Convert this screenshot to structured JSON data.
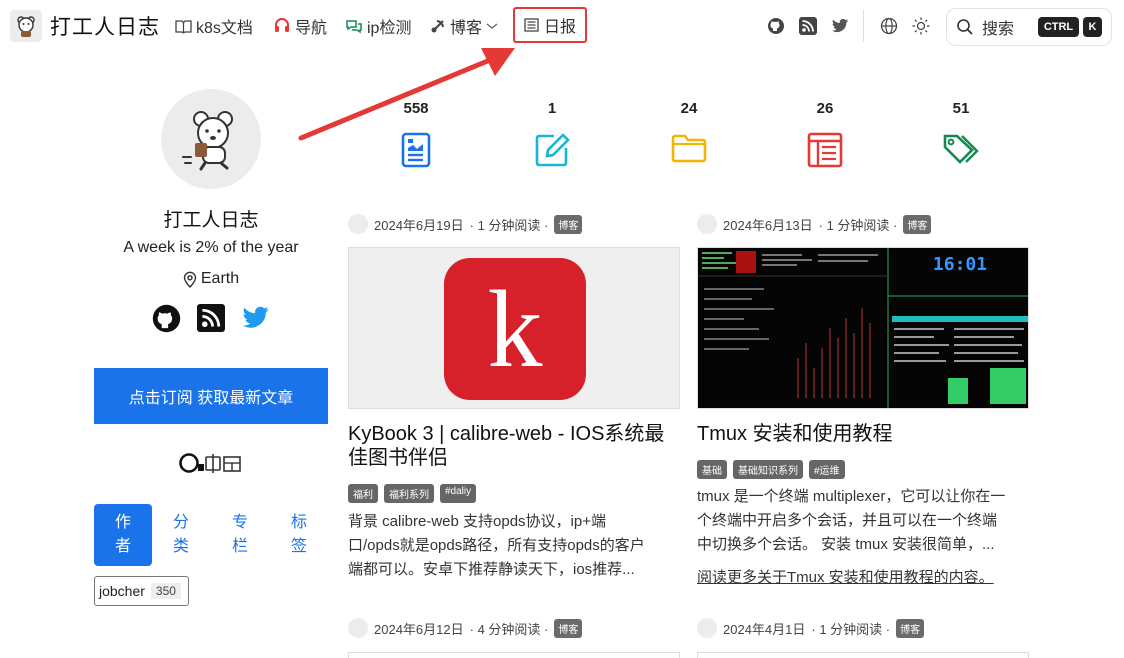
{
  "site": {
    "title": "打工人日志"
  },
  "nav": {
    "k8s": "k8s文档",
    "guide": "导航",
    "ip": "ip检测",
    "blog": "博客",
    "daily": "日报"
  },
  "search": {
    "label": "搜索",
    "kbd_ctrl": "CTRL",
    "kbd_k": "K"
  },
  "author": {
    "name": "打工人日志",
    "bio": "A week is 2% of the year",
    "location": "Earth",
    "subscribe": "点击订阅 获取最新文章",
    "tabs": [
      {
        "line1": "作",
        "line2": "者"
      },
      {
        "line1": "分",
        "line2": "类"
      },
      {
        "line1": "专",
        "line2": "栏"
      },
      {
        "line1": "标",
        "line2": "签"
      }
    ],
    "tag": {
      "name": "jobcher",
      "count": "350"
    }
  },
  "stats": [
    {
      "value": "558",
      "icon": "document-icon",
      "color": "#1a73e8"
    },
    {
      "value": "1",
      "icon": "edit-icon",
      "color": "#17b5d8"
    },
    {
      "value": "24",
      "icon": "folder-icon",
      "color": "#f5b400"
    },
    {
      "value": "26",
      "icon": "columns-icon",
      "color": "#e53935"
    },
    {
      "value": "51",
      "icon": "tags-icon",
      "color": "#138a50"
    }
  ],
  "posts": [
    {
      "date": "2024年6月19日",
      "read": "· 1 分钟阅读 ·",
      "category": "博客",
      "title_line1": "KyBook 3 | calibre-web - IOS系统最",
      "title_line2": "佳图书伴侣",
      "tags": [
        "福利",
        "福利系列",
        "#daliy"
      ],
      "excerpt": [
        "背景 calibre-web 支持opds协议，ip+端",
        "口/opds就是opds路径，所有支持opds的客户",
        "端都可以。安卓下推荐静读天下，ios推荐..."
      ],
      "thumb_letter": "k"
    },
    {
      "date": "2024年6月13日",
      "read": "· 1 分钟阅读 ·",
      "category": "博客",
      "title_line1": "Tmux 安装和使用教程",
      "tags": [
        "基础",
        "基础知识系列",
        "#运维"
      ],
      "excerpt": [
        "tmux 是一个终端 multiplexer，它可以让你在一",
        "个终端中开启多个会话，并且可以在一个终端",
        "中切换多个会话。 安装 tmux 安装很简单，..."
      ],
      "readmore": "阅读更多关于Tmux 安装和使用教程的内容。",
      "clock": "16:01"
    },
    {
      "date": "2024年6月12日",
      "read": "· 4 分钟阅读 ·",
      "category": "博客"
    },
    {
      "date": "2024年4月1日",
      "read": "· 1 分钟阅读 ·",
      "category": "博客"
    }
  ],
  "colors": {
    "accent": "#1a73e8",
    "highlight": "#e53935",
    "kybook_red": "#d6202a"
  }
}
